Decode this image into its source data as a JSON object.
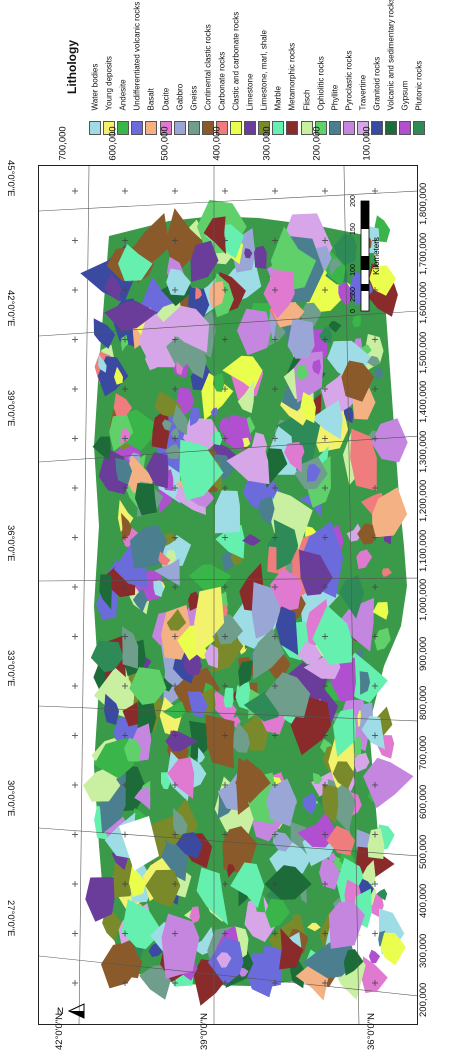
{
  "legend": {
    "title": "Lithology",
    "items": [
      {
        "label": "Water bodies",
        "color": "#9fdde6"
      },
      {
        "label": "Young deposits",
        "color": "#f2f26d"
      },
      {
        "label": "Andesite",
        "color": "#39b54a"
      },
      {
        "label": "Undifferentiated volcanic rocks",
        "color": "#6b6bdb"
      },
      {
        "label": "Basalt",
        "color": "#f4b183"
      },
      {
        "label": "Dacite",
        "color": "#e07ad0"
      },
      {
        "label": "Gabbro",
        "color": "#9aa7d6"
      },
      {
        "label": "Gneiss",
        "color": "#6f9e8c"
      },
      {
        "label": "Continental clastic rocks",
        "color": "#8b5a2b"
      },
      {
        "label": "Carbonate rocks",
        "color": "#f07d7d"
      },
      {
        "label": "Clastic and carbonate rocks",
        "color": "#eaff4d"
      },
      {
        "label": "Limestone",
        "color": "#6a3d9a"
      },
      {
        "label": "Limestone, marl, shale",
        "color": "#7a8a2a"
      },
      {
        "label": "Marble",
        "color": "#66f0b0"
      },
      {
        "label": "Metamorphic rocks",
        "color": "#8a2b2b"
      },
      {
        "label": "Flisch",
        "color": "#c8f0a0"
      },
      {
        "label": "Ophiolitic rocks",
        "color": "#5fd06a"
      },
      {
        "label": "Phyllite",
        "color": "#4b7f8f"
      },
      {
        "label": "Pyroclastic rocks",
        "color": "#c586e0"
      },
      {
        "label": "Travertine",
        "color": "#d6a6e8"
      },
      {
        "label": "Granitoid rocks",
        "color": "#3a4aa0"
      },
      {
        "label": "Volcanic and sedimentary rocks",
        "color": "#1e6b3a"
      },
      {
        "label": "Gypsum",
        "color": "#b050d0"
      },
      {
        "label": "Plutonic rocks",
        "color": "#2e8b57"
      }
    ]
  },
  "x_ticks": [
    "700,000",
    "600,000",
    "500,000",
    "400,000",
    "300,000",
    "200,000",
    "100,000"
  ],
  "y_ticks": [
    "1,800,000",
    "1,700,000",
    "1,600,000",
    "1,500,000",
    "1,400,000",
    "1,300,000",
    "1,200,000",
    "1,100,000",
    "1,000,000",
    "900,000",
    "800,000",
    "700,000",
    "600,000",
    "500,000",
    "400,000",
    "300,000",
    "200,000"
  ],
  "lon_labels": [
    "45°0'0\"E",
    "42°0'0\"E",
    "39°0'0\"E",
    "36°0'0\"E",
    "33°0'0\"E",
    "30°0'0\"E",
    "27°0'0\"E"
  ],
  "lat_labels": [
    "42°0'0\"N",
    "39°0'0\"N",
    "36°0'0\"N"
  ],
  "scale_bar": {
    "unit": "Kilometers",
    "ticks": [
      "0",
      "25",
      "50",
      "100",
      "150",
      "200"
    ]
  },
  "north_label": "N"
}
